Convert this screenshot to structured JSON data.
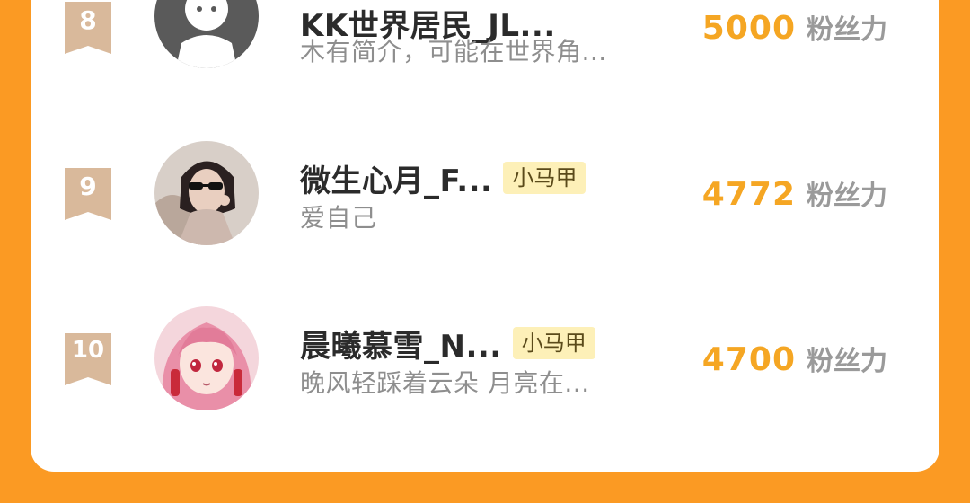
{
  "colors": {
    "background": "#fb9a23",
    "panel": "#ffffff",
    "score": "#f5a623",
    "badge": "#d9b99b",
    "tag_bg": "#fdf0b8"
  },
  "ranking": {
    "items": [
      {
        "rank": "8",
        "name": "KK世界居民_JL...",
        "tag": "",
        "bio": "木有简介，可能在世界角...",
        "score": "5000",
        "unit": "粉丝力",
        "avatar_icon": "default-avatar-icon"
      },
      {
        "rank": "9",
        "name": "微生心月_F...",
        "tag": "小马甲",
        "bio": "爱自己",
        "score": "4772",
        "unit": "粉丝力",
        "avatar_icon": "user-photo-avatar"
      },
      {
        "rank": "10",
        "name": "晨曦慕雪_N...",
        "tag": "小马甲",
        "bio": "晚风轻踩着云朵 月亮在...",
        "score": "4700",
        "unit": "粉丝力",
        "avatar_icon": "anime-avatar"
      }
    ]
  }
}
